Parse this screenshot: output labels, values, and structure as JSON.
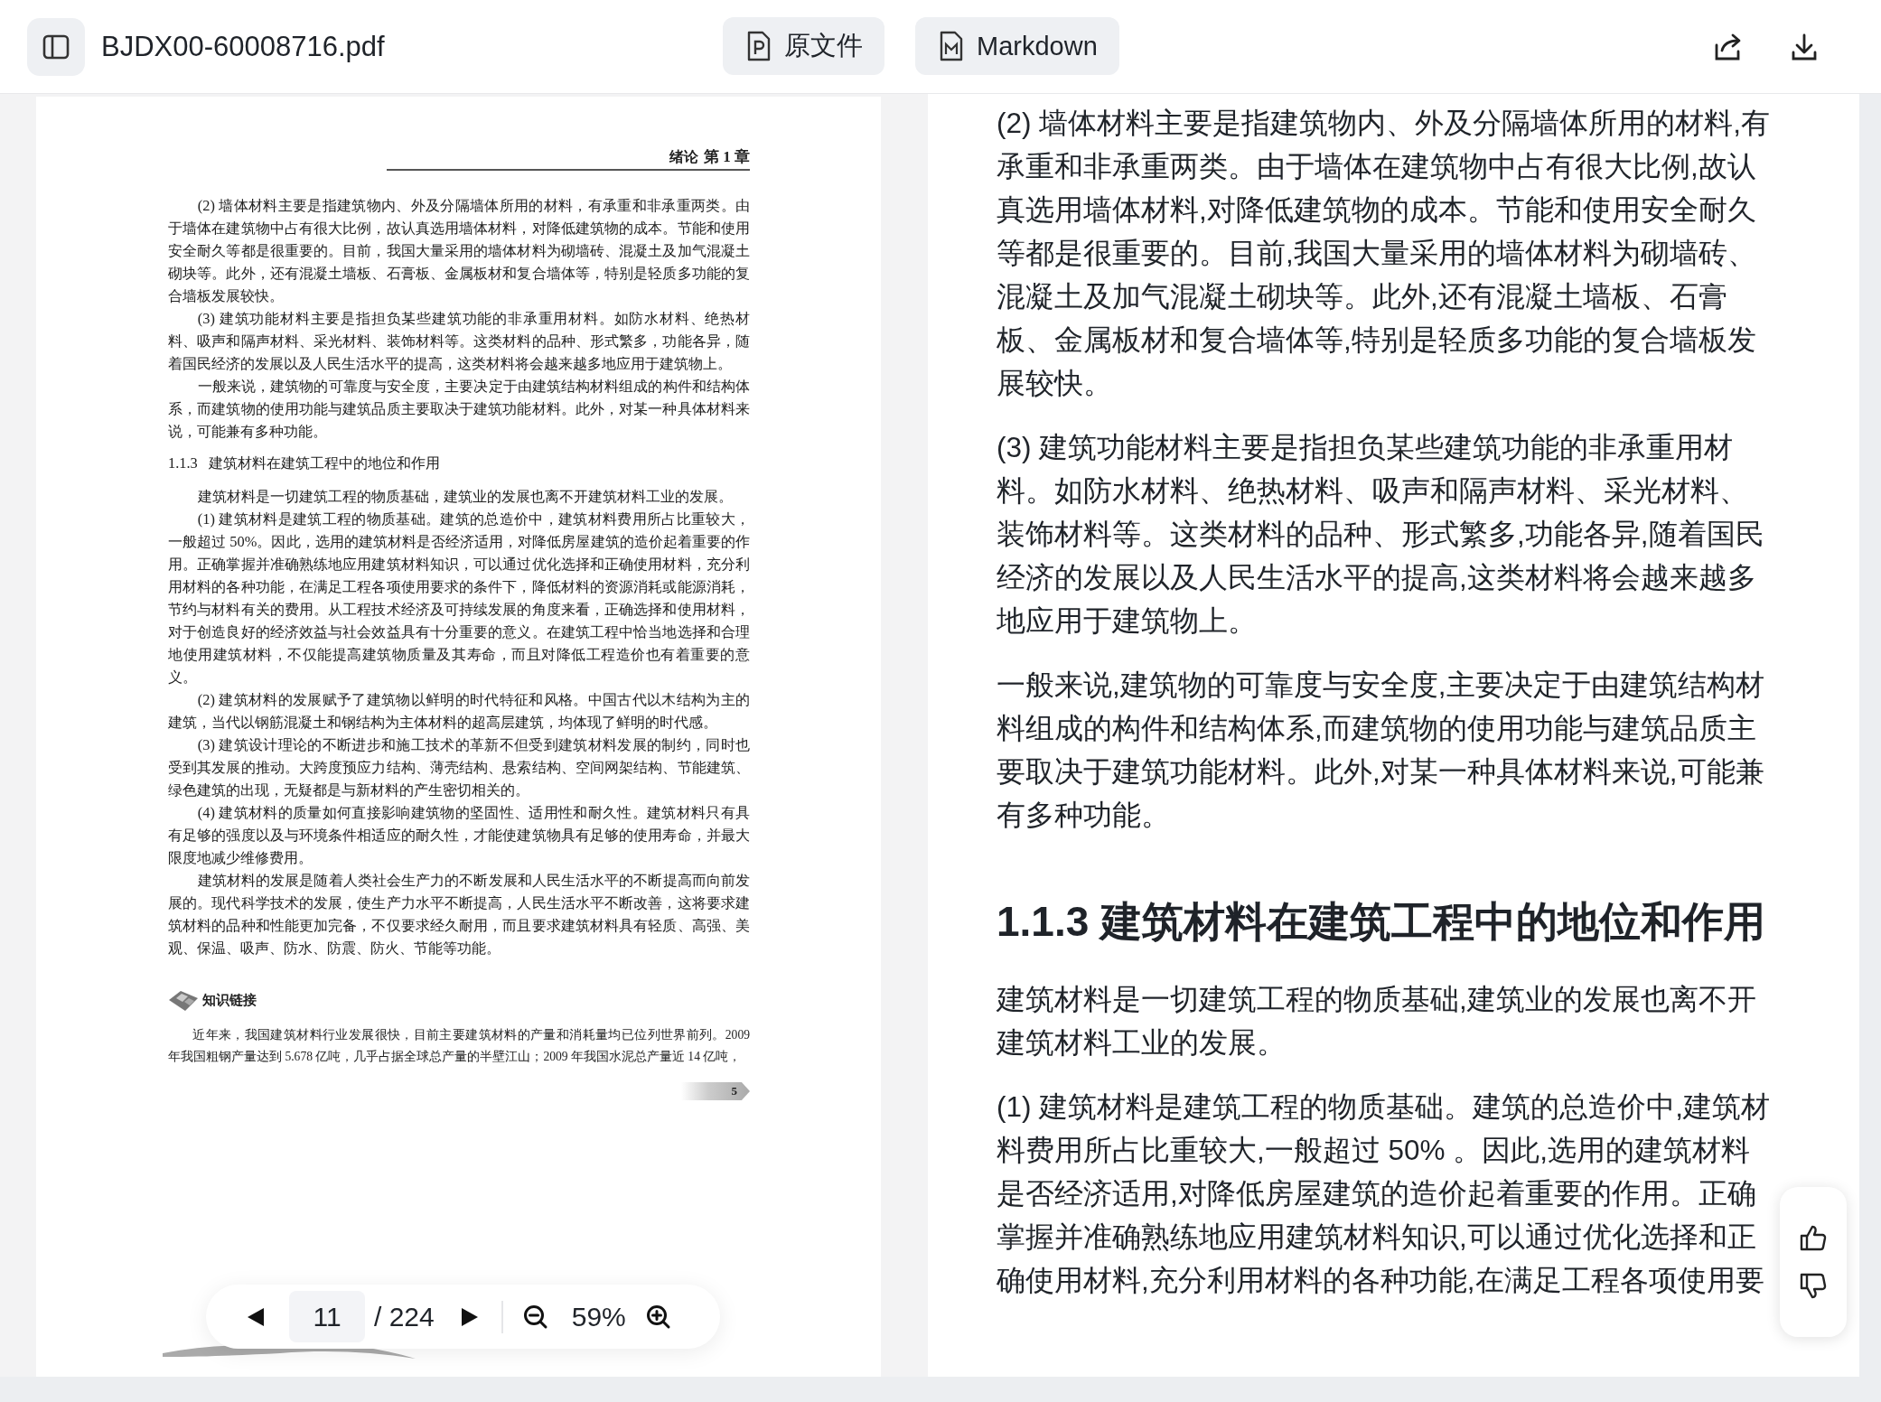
{
  "file": {
    "name": "BJDX00-60008716.pdf"
  },
  "view_tabs": [
    {
      "label": "原文件",
      "selected": true
    },
    {
      "label": "Markdown",
      "selected": true
    }
  ],
  "pdf_page": {
    "section": "绪论",
    "chapter": "第 1 章",
    "blocks": [
      {
        "kind": "paragraph",
        "text": "(2) 墙体材料主要是指建筑物内、外及分隔墙体所用的材料，有承重和非承重两类。由于墙体在建筑物中占有很大比例，故认真选用墙体材料，对降低建筑物的成本。节能和使用安全耐久等都是很重要的。目前，我国大量采用的墙体材料为砌墙砖、混凝土及加气混凝土砌块等。此外，还有混凝土墙板、石膏板、金属板材和复合墙体等，特别是轻质多功能的复合墙板发展较快。"
      },
      {
        "kind": "paragraph",
        "text": "(3) 建筑功能材料主要是指担负某些建筑功能的非承重用材料。如防水材料、绝热材料、吸声和隔声材料、采光材料、装饰材料等。这类材料的品种、形式繁多，功能各异，随着国民经济的发展以及人民生活水平的提高，这类材料将会越来越多地应用于建筑物上。"
      },
      {
        "kind": "paragraph",
        "text": "一般来说，建筑物的可靠度与安全度，主要决定于由建筑结构材料组成的构件和结构体系，而建筑物的使用功能与建筑品质主要取决于建筑功能材料。此外，对某一种具体材料来说，可能兼有多种功能。"
      },
      {
        "kind": "heading",
        "text": "1.1.3   建筑材料在建筑工程中的地位和作用"
      },
      {
        "kind": "paragraph",
        "text": "建筑材料是一切建筑工程的物质基础，建筑业的发展也离不开建筑材料工业的发展。"
      },
      {
        "kind": "paragraph",
        "text": "(1) 建筑材料是建筑工程的物质基础。建筑的总造价中，建筑材料费用所占比重较大，一般超过 50%。因此，选用的建筑材料是否经济适用，对降低房屋建筑的造价起着重要的作用。正确掌握并准确熟练地应用建筑材料知识，可以通过优化选择和正确使用材料，充分利用材料的各种功能，在满足工程各项使用要求的条件下，降低材料的资源消耗或能源消耗，节约与材料有关的费用。从工程技术经济及可持续发展的角度来看，正确选择和使用材料，对于创造良好的经济效益与社会效益具有十分重要的意义。在建筑工程中恰当地选择和合理地使用建筑材料，不仅能提高建筑物质量及其寿命，而且对降低工程造价也有着重要的意义。"
      },
      {
        "kind": "paragraph",
        "text": "(2) 建筑材料的发展赋予了建筑物以鲜明的时代特征和风格。中国古代以木结构为主的建筑，当代以钢筋混凝土和钢结构为主体材料的超高层建筑，均体现了鲜明的时代感。"
      },
      {
        "kind": "paragraph",
        "text": "(3) 建筑设计理论的不断进步和施工技术的革新不但受到建筑材料发展的制约，同时也受到其发展的推动。大跨度预应力结构、薄壳结构、悬索结构、空间网架结构、节能建筑、绿色建筑的出现，无疑都是与新材料的产生密切相关的。"
      },
      {
        "kind": "paragraph",
        "text": "(4) 建筑材料的质量如何直接影响建筑物的坚固性、适用性和耐久性。建筑材料只有具有足够的强度以及与环境条件相适应的耐久性，才能使建筑物具有足够的使用寿命，并最大限度地减少维修费用。"
      },
      {
        "kind": "paragraph",
        "text": "建筑材料的发展是随着人类社会生产力的不断发展和人民生活水平的不断提高而向前发展的。现代科学技术的发展，使生产力水平不断提高，人民生活水平不断改善，这将要求建筑材料的品种和性能更加完备，不仅要求经久耐用，而且要求建筑材料具有轻质、高强、美观、保温、吸声、防水、防震、防火、节能等功能。"
      }
    ],
    "knowledge_link": {
      "title": "知识链接",
      "text": "近年来，我国建筑材料行业发展很快，目前主要建筑材料的产量和消耗量均已位列世界前列。2009 年我国粗钢产量达到 5.678 亿吨，几乎占据全球总产量的半壁江山；2009 年我国水泥总产量近 14 亿吨，"
    },
    "page_number": "5"
  },
  "toolbar": {
    "page": "11",
    "total": "/ 224",
    "zoom": "59%"
  },
  "markdown": {
    "blocks": [
      {
        "kind": "paragraph",
        "text": "(2) 墙体材料主要是指建筑物内、外及分隔墙体所用的材料,有承重和非承重两类。由于墙体在建筑物中占有很大比例,故认真选用墙体材料,对降低建筑物的成本。节能和使用安全耐久等都是很重要的。目前,我国大量采用的墙体材料为砌墙砖、混凝土及加气混凝土砌块等。此外,还有混凝土墙板、石膏板、金属板材和复合墙体等,特别是轻质多功能的复合墙板发展较快。"
      },
      {
        "kind": "paragraph",
        "text": "(3) 建筑功能材料主要是指担负某些建筑功能的非承重用材料。如防水材料、绝热材料、吸声和隔声材料、采光材料、装饰材料等。这类材料的品种、形式繁多,功能各异,随着国民经济的发展以及人民生活水平的提高,这类材料将会越来越多地应用于建筑物上。"
      },
      {
        "kind": "paragraph",
        "text": "一般来说,建筑物的可靠度与安全度,主要决定于由建筑结构材料组成的构件和结构体系,而建筑物的使用功能与建筑品质主要取决于建筑功能材料。此外,对某一种具体材料来说,可能兼有多种功能。"
      },
      {
        "kind": "heading",
        "text": "1.1.3 建筑材料在建筑工程中的地位和作用"
      },
      {
        "kind": "paragraph",
        "text": "建筑材料是一切建筑工程的物质基础,建筑业的发展也离不开建筑材料工业的发展。"
      },
      {
        "kind": "paragraph",
        "text": "(1) 建筑材料是建筑工程的物质基础。建筑的总造价中,建筑材料费用所占比重较大,一般超过 50% 。因此,选用的建筑材料是否经济适用,对降低房屋建筑的造价起着重要的作用。正确掌握并准确熟练地应用建筑材料知识,可以通过优化选择和正确使用材料,充分利用材料的各种功能,在满足工程各项使用要"
      }
    ]
  }
}
